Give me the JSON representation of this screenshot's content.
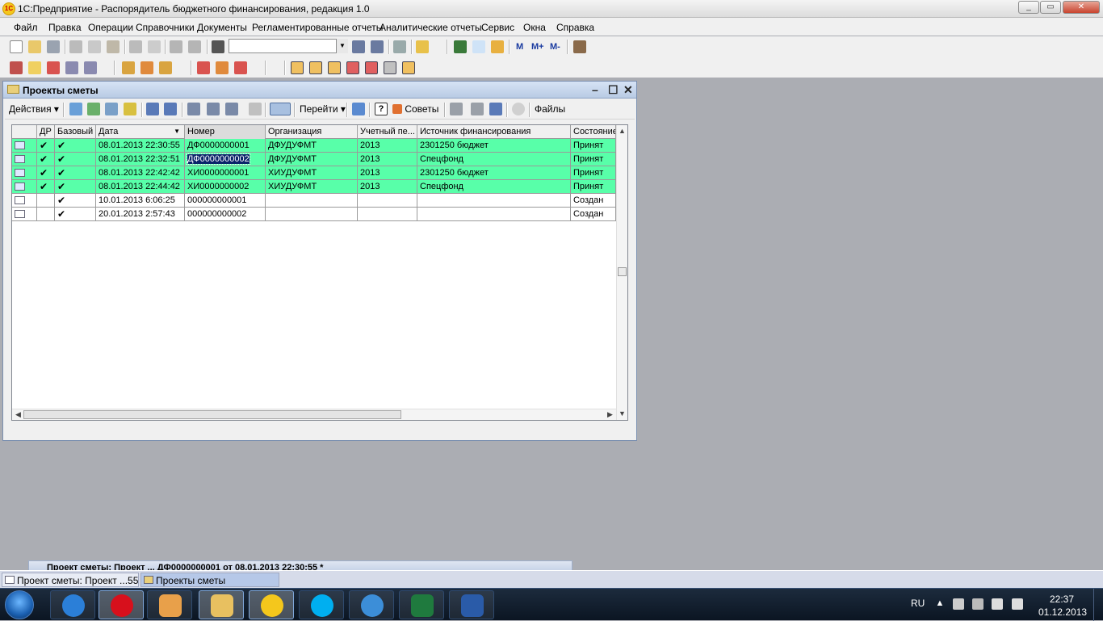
{
  "app": {
    "title": "1С:Предприятие - Распорядитель бюджетного финансирования, редакция 1.0",
    "logo_text": "1С"
  },
  "window_buttons": {
    "minimize": "_",
    "restore": "▭",
    "close": "✕"
  },
  "menu": [
    "Файл",
    "Правка",
    "Операции",
    "Справочники",
    "Документы",
    "Регламентированные отчеты",
    "Аналитические отчеты",
    "Сервис",
    "Окна",
    "Справка"
  ],
  "toolbar1": {
    "search_value": "",
    "memory_buttons": [
      "M",
      "M+",
      "M-"
    ]
  },
  "doc_window": {
    "title": "Проекты сметы",
    "actions_label": "Действия",
    "goto_label": "Перейти",
    "tips_label": "Советы",
    "files_label": "Файлы",
    "help_label": "?",
    "columns": [
      "",
      "ДР",
      "Базовый",
      "Дата",
      "Номер",
      "Организация",
      "Учетный пе...",
      "Источник финансирования",
      "Состояние"
    ],
    "rows": [
      {
        "dr": "✔",
        "base": "✔",
        "date": "08.01.2013 22:30:55",
        "number": "ДФ0000000001",
        "org": "ДФУДУФМТ",
        "period": "2013",
        "source": "2301250 бюджет",
        "state": "Принят",
        "accepted": true
      },
      {
        "dr": "✔",
        "base": "✔",
        "date": "08.01.2013 22:32:51",
        "number": "ДФ0000000002",
        "org": "ДФУДУФМТ",
        "period": "2013",
        "source": "Спецфонд",
        "state": "Принят",
        "accepted": true,
        "selected": true
      },
      {
        "dr": "✔",
        "base": "✔",
        "date": "08.01.2013 22:42:42",
        "number": "ХИ0000000001",
        "org": "ХИУДУФМТ",
        "period": "2013",
        "source": "2301250 бюджет",
        "state": "Принят",
        "accepted": true
      },
      {
        "dr": "✔",
        "base": "✔",
        "date": "08.01.2013 22:44:42",
        "number": "ХИ0000000002",
        "org": "ХИУДУФМТ",
        "period": "2013",
        "source": "Спецфонд",
        "state": "Принят",
        "accepted": true
      },
      {
        "dr": "",
        "base": "✔",
        "date": "10.01.2013 6:06:25",
        "number": "000000000001",
        "org": "",
        "period": "",
        "source": "",
        "state": "Создан",
        "accepted": false
      },
      {
        "dr": "",
        "base": "✔",
        "date": "20.01.2013 2:57:43",
        "number": "000000000002",
        "org": "",
        "period": "",
        "source": "",
        "state": "Создан",
        "accepted": false
      }
    ]
  },
  "hidden_window_title": "Проект сметы: Проект ...   ДФ0000000001 от 08.01.2013 22:30:55 *",
  "open_windows": [
    "Проект сметы: Проект ...55 *",
    "Проекты сметы"
  ],
  "taskbar": {
    "apps": [
      "internet-explorer",
      "opera",
      "media-player",
      "file-explorer",
      "1c-enterprise",
      "skype",
      "itunes",
      "excel",
      "word"
    ],
    "language": "RU",
    "time": "22:37",
    "date": "01.12.2013"
  },
  "colors": {
    "accepted_row": "#58ffa9",
    "selection": "#0a246a"
  }
}
